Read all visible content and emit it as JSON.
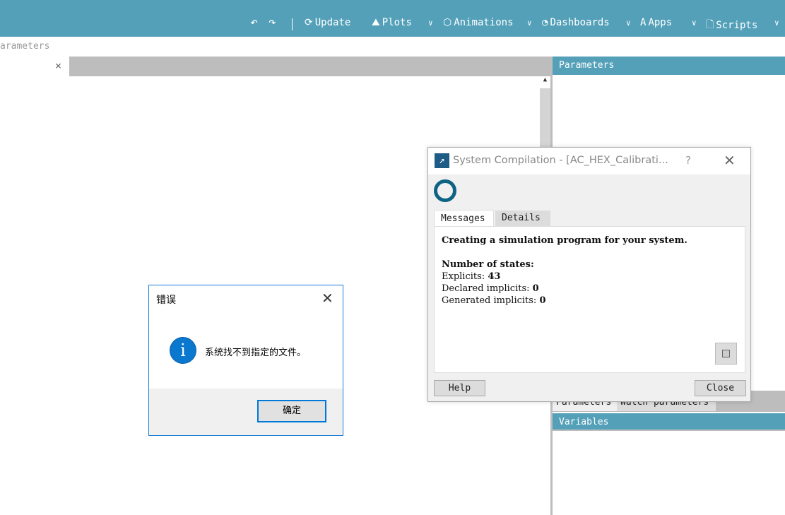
{
  "toolbar": {
    "undo_icon": "undo-icon",
    "redo_icon": "redo-icon",
    "update": "Update",
    "plots": "Plots",
    "animations": "Animations",
    "dashboards": "Dashboards",
    "apps": "Apps",
    "scripts": "Scripts",
    "accent_color": "#54a0b9"
  },
  "breadcrumb": "arameters",
  "right_panel": {
    "parameters_header": "Parameters",
    "tabs": [
      "Parameters",
      "Watch parameters"
    ],
    "variables_header": "Variables"
  },
  "compilation_dialog": {
    "title": "System Compilation - [AC_HEX_Calibrati...",
    "help_glyph": "?",
    "tabs": [
      "Messages",
      "Details"
    ],
    "message_heading": "Creating a simulation program for your system.",
    "states_heading": "Number of states:",
    "explicits_label": "Explicits: ",
    "explicits_value": "43",
    "declared_label": "Declared implicits: ",
    "declared_value": "0",
    "generated_label": "Generated implicits: ",
    "generated_value": "0",
    "help_button": "Help",
    "close_button": "Close"
  },
  "error_dialog": {
    "title": "错误",
    "message": "系统找不到指定的文件。",
    "ok_button": "确定",
    "icon": "info-icon"
  }
}
